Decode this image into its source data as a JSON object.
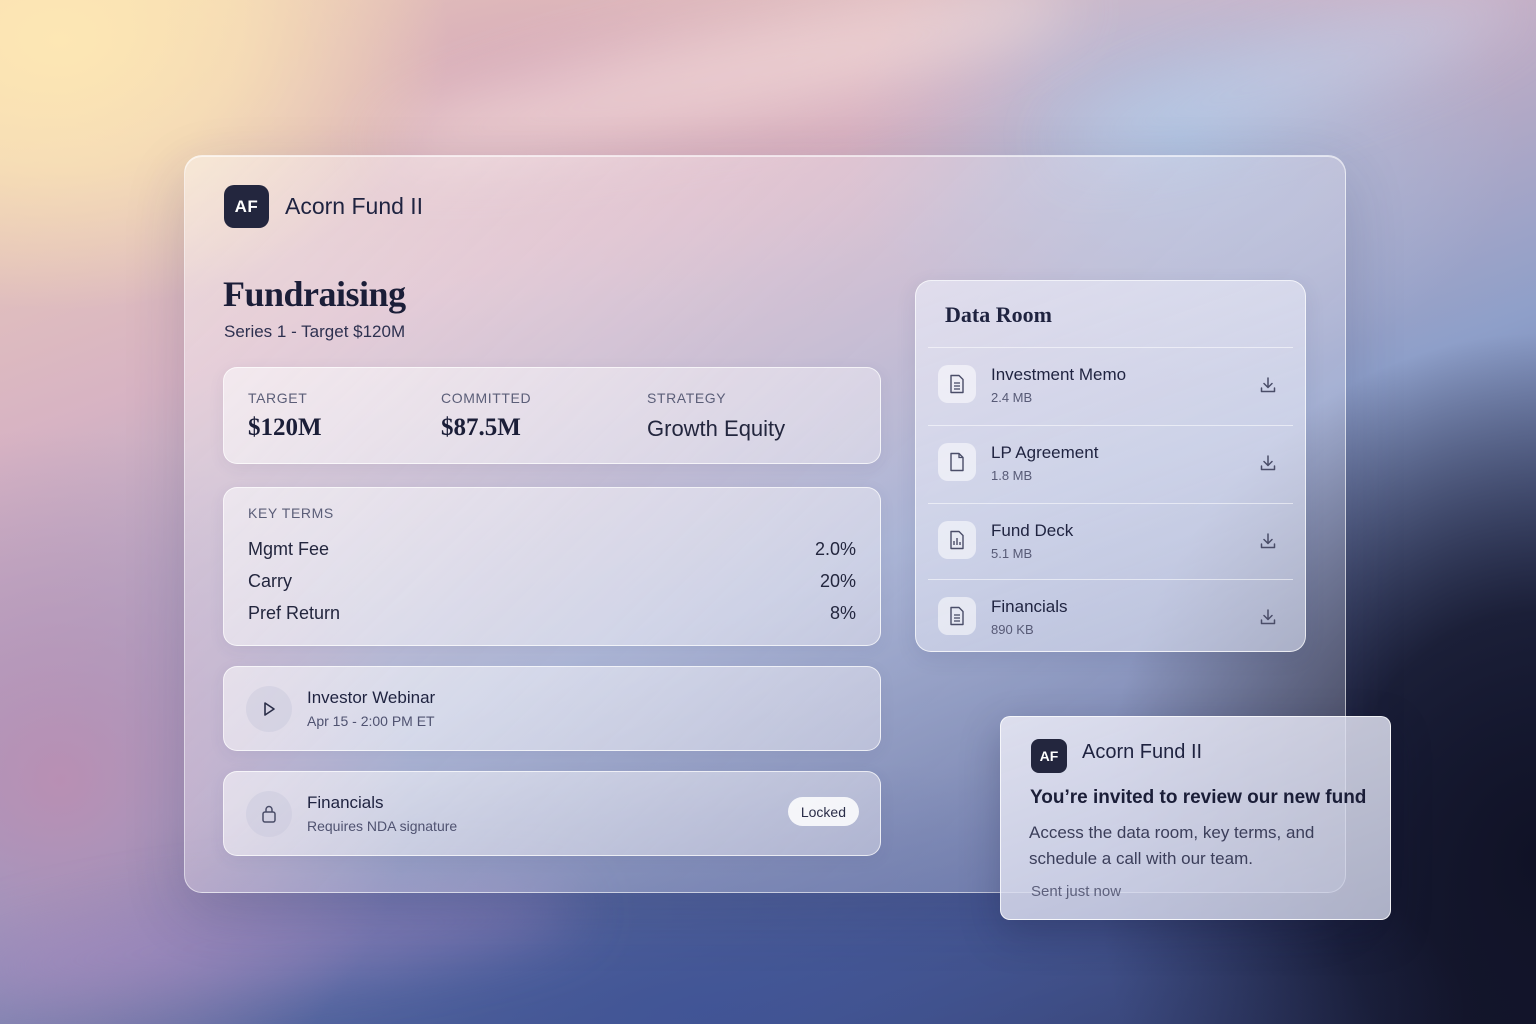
{
  "app": {
    "initials": "AF",
    "name": "Acorn Fund II"
  },
  "page": {
    "title": "Fundraising",
    "subtitle": "Series 1 - Target $120M"
  },
  "stats": [
    {
      "label": "TARGET",
      "value": "$120M"
    },
    {
      "label": "COMMITTED",
      "value": "$87.5M"
    },
    {
      "label": "STRATEGY",
      "value": "Growth Equity"
    }
  ],
  "key_terms": {
    "label": "KEY TERMS",
    "rows": [
      {
        "name": "Mgmt Fee",
        "value": "2.0%"
      },
      {
        "name": "Carry",
        "value": "20%"
      },
      {
        "name": "Pref Return",
        "value": "8%"
      }
    ]
  },
  "webinar": {
    "icon": "play-icon",
    "title": "Investor Webinar",
    "subtitle": "Apr 15 - 2:00 PM ET"
  },
  "financials_locked": {
    "icon": "lock-icon",
    "title": "Financials",
    "subtitle": "Requires NDA signature",
    "badge": "Locked"
  },
  "data_room": {
    "title": "Data Room",
    "files": [
      {
        "name": "Investment Memo",
        "size": "2.4 MB",
        "icon": "document-lines-icon"
      },
      {
        "name": "LP Agreement",
        "size": "1.8 MB",
        "icon": "document-blank-icon"
      },
      {
        "name": "Fund Deck",
        "size": "5.1 MB",
        "icon": "document-chart-icon"
      },
      {
        "name": "Financials",
        "size": "890 KB",
        "icon": "document-lines-icon"
      }
    ]
  },
  "notification": {
    "initials": "AF",
    "brand": "Acorn Fund II",
    "title": "You’re invited to review our new fund",
    "body": "Access the data room, key terms, and schedule a call with our team.",
    "time": "Sent just now"
  },
  "colors": {
    "brand_dark": "#23263e",
    "text_primary": "#1f2340",
    "text_muted": "#5b5e78"
  }
}
